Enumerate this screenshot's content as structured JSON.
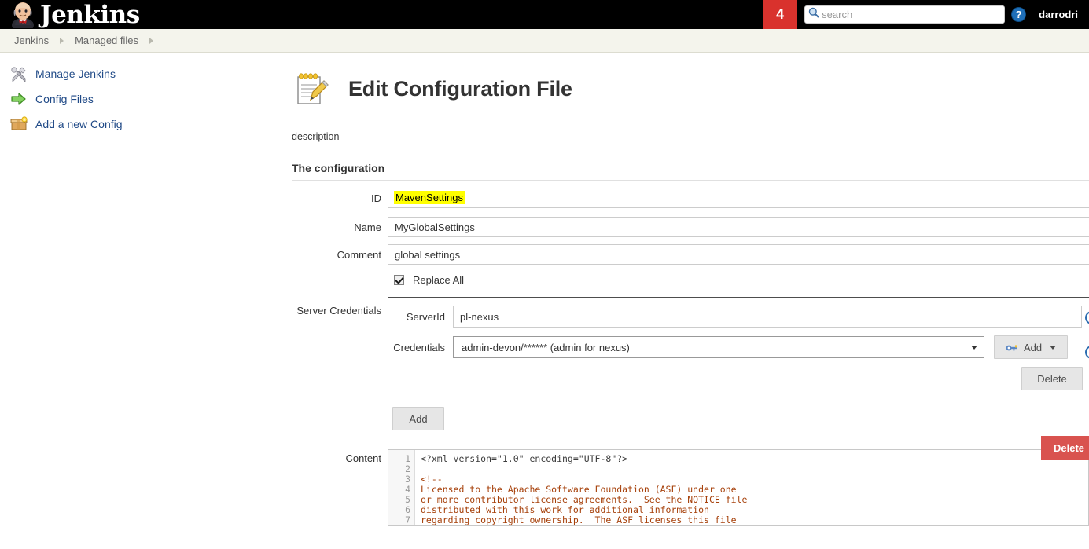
{
  "header": {
    "brand": "Jenkins",
    "logo_icon": "jenkins-butler-icon",
    "notification_count": "4",
    "search_placeholder": "search",
    "search_value": "",
    "search_icon": "search-icon",
    "help_icon": "help-icon",
    "user": "darrodri"
  },
  "breadcrumb": {
    "items": [
      {
        "label": "Jenkins"
      },
      {
        "label": "Managed files"
      }
    ]
  },
  "sidebar": {
    "items": [
      {
        "label": "Manage Jenkins",
        "icon": "wrench-screwdriver-icon"
      },
      {
        "label": "Config Files",
        "icon": "green-arrow-icon"
      },
      {
        "label": "Add a new Config",
        "icon": "new-package-icon"
      }
    ]
  },
  "main": {
    "title": "Edit Configuration File",
    "title_icon": "notepad-pencil-icon",
    "description_label": "description",
    "section_title": "The configuration",
    "fields": {
      "id_label": "ID",
      "id_value": "MavenSettings",
      "name_label": "Name",
      "name_value": "MyGlobalSettings",
      "comment_label": "Comment",
      "comment_value": "global settings",
      "replace_all_label": "Replace All",
      "replace_all_checked": true
    },
    "server_credentials": {
      "label": "Server Credentials",
      "server_id_label": "ServerId",
      "server_id_value": "pl-nexus",
      "credentials_label": "Credentials",
      "credentials_value": "admin-devon/****** (admin for nexus)",
      "add_credentials_label": "Add",
      "add_credentials_icon": "key-icon",
      "delete_entry_label": "Delete",
      "add_entry_label": "Add",
      "help_icon": "help-icon"
    },
    "delete_config_label": "Delete",
    "content": {
      "label": "Content",
      "lines": [
        {
          "n": "1",
          "text": "<?xml version=\"1.0\" encoding=\"UTF-8\"?>",
          "kind": "decl"
        },
        {
          "n": "2",
          "text": "",
          "kind": "decl"
        },
        {
          "n": "3",
          "text": "<!--",
          "kind": "comment"
        },
        {
          "n": "4",
          "text": "Licensed to the Apache Software Foundation (ASF) under one",
          "kind": "comment"
        },
        {
          "n": "5",
          "text": "or more contributor license agreements.  See the NOTICE file",
          "kind": "comment"
        },
        {
          "n": "6",
          "text": "distributed with this work for additional information",
          "kind": "comment"
        },
        {
          "n": "7",
          "text": "regarding copyright ownership.  The ASF licenses this file",
          "kind": "comment"
        }
      ]
    }
  },
  "colors": {
    "topbar_bg": "#000000",
    "badge_red": "#d9322d",
    "breadcrumb_bg": "#f4f4ec",
    "link_blue": "#204a87",
    "delete_red": "#d9534f",
    "highlight_yellow": "#ffff00",
    "code_comment": "#a6400a"
  }
}
